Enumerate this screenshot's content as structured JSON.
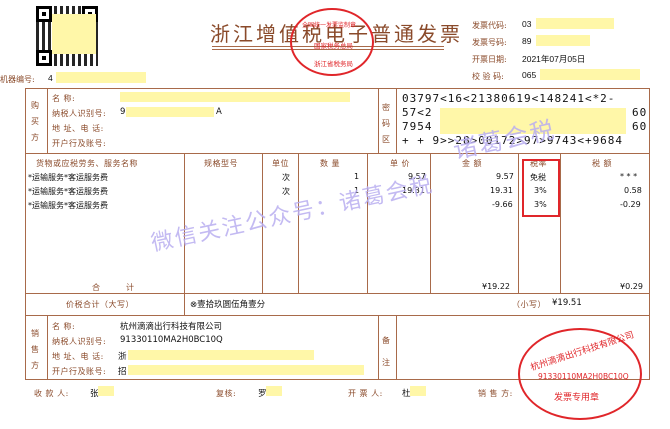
{
  "header": {
    "title": "浙江增值税电子普通发票",
    "invoice_code_label": "发票代码:",
    "invoice_code": "03",
    "invoice_no_label": "发票号码:",
    "invoice_no": "89",
    "issue_date_label": "开票日期:",
    "issue_date": "2021年07月05日",
    "check_code_label": "校 验 码:",
    "check_code": "065",
    "machine_no_label": "机器编号:",
    "machine_no": "4"
  },
  "buyer": {
    "side_label": [
      "购",
      "买",
      "方"
    ],
    "name_label": "名 称:",
    "name_value": "",
    "tax_id_label": "纳税人识别号:",
    "tax_id_value": "9",
    "addr_label": "地 址、电 话:",
    "bank_label": "开户行及账号:"
  },
  "password_zone": {
    "side_label": [
      "密",
      "码",
      "区"
    ],
    "lines": [
      "03797<16<21380619<148241<*2-",
      "57<2",
      "7954",
      "+ + 9>>28>00172>97>9743<+9684"
    ],
    "line_tails": [
      "",
      "60",
      "60",
      ""
    ]
  },
  "table": {
    "headers": {
      "item": "货物或应税劳务、服务名称",
      "spec": "规格型号",
      "unit": "单位",
      "qty": "数 量",
      "price": "单 价",
      "amount": "金 额",
      "rate": "税率",
      "tax": "税 额"
    },
    "rows": [
      {
        "item": "*运输服务*客运服务费",
        "unit": "次",
        "qty": "1",
        "price": "9.57",
        "amount": "9.57",
        "rate": "免税",
        "tax": "* * *"
      },
      {
        "item": "*运输服务*客运服务费",
        "unit": "次",
        "qty": "1",
        "price": "19.31",
        "amount": "19.31",
        "rate": "3%",
        "tax": "0.58"
      },
      {
        "item": "*运输服务*客运服务费",
        "unit": "",
        "qty": "",
        "price": "",
        "amount": "-9.66",
        "rate": "3%",
        "tax": "-0.29"
      }
    ],
    "total_label": "合　　　计",
    "total_amount": "¥19.22",
    "total_tax": "¥0.29"
  },
  "total_in_words": {
    "label": "价税合计（大写）",
    "value": "⊗壹拾玖圆伍角壹分",
    "small_label": "（小写）",
    "small_value": "¥19.51"
  },
  "seller": {
    "side_label": [
      "销",
      "售",
      "方"
    ],
    "name_label": "名 称:",
    "name_value": "杭州滴滴出行科技有限公司",
    "tax_id_label": "纳税人识别号:",
    "tax_id_value": "91330110MA2H0BC10Q",
    "addr_label": "地 址、电 话:",
    "addr_value": "浙",
    "bank_label": "开户行及账号:",
    "bank_value": "招"
  },
  "remarks": {
    "side_label": [
      "备",
      "注"
    ]
  },
  "footer": {
    "payee_label": "收 款 人:",
    "payee_value": "张",
    "reviewer_label": "复核:",
    "reviewer_value": "罗",
    "drawer_label": "开 票 人:",
    "drawer_value": "杜",
    "seller_label": "销 售 方:"
  },
  "watermarks": {
    "wm1": "微信关注公众号：诸葛会税",
    "wm2": "诸葛会税"
  },
  "seals": {
    "tax_seal_top": "全国统一发票监制章",
    "tax_seal_mid": "国家税务总局",
    "tax_seal_bottom": "浙江省税务局",
    "company_seal_top": "杭州滴滴出行科技有限公司",
    "company_seal_mid": "91330110MA2H0BC10Q",
    "company_seal_bottom": "发票专用章"
  },
  "colors": {
    "frame": "#a86a4a",
    "seal": "#e0262a",
    "highlight": "#fff7a8",
    "watermark": "#b9aef0"
  }
}
